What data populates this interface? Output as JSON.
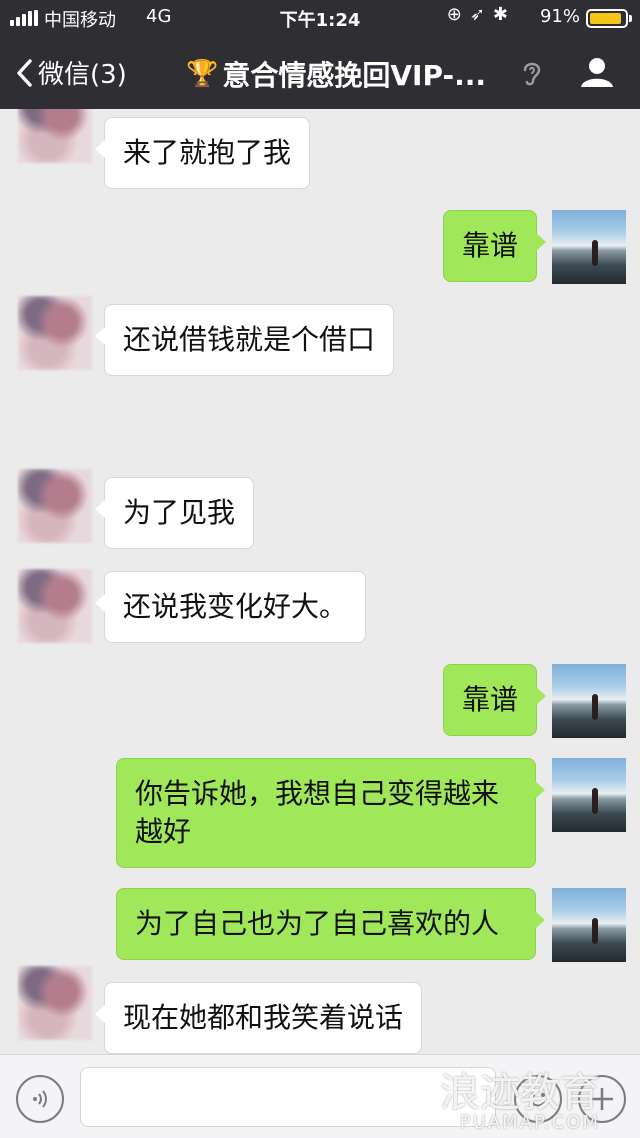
{
  "status_bar": {
    "carrier": "中国移动",
    "network": "4G",
    "time": "下午1:24",
    "battery_percent": "91%",
    "battery_level": 0.91,
    "icons": [
      "lock-rotation-icon",
      "location-icon",
      "bluetooth-icon"
    ]
  },
  "nav": {
    "back_label": "微信(3)",
    "title_icon": "🏆",
    "title": "意合情感挽回VIP-...",
    "ear_icon": "ear-icon",
    "profile_icon": "person-icon"
  },
  "messages": [
    {
      "side": "left",
      "text": "来了就抱了我"
    },
    {
      "side": "right",
      "text": "靠谱"
    },
    {
      "side": "left",
      "text": "还说借钱就是个借口"
    },
    {
      "side": "left",
      "text": "为了见我"
    },
    {
      "side": "left",
      "text": "还说我变化好大。"
    },
    {
      "side": "right",
      "text": "靠谱"
    },
    {
      "side": "right",
      "text": "你告诉她，我想自己变得越来越好"
    },
    {
      "side": "right",
      "text": "为了自己也为了自己喜欢的人"
    },
    {
      "side": "left",
      "text": "现在她都和我笑着说话"
    }
  ],
  "input_bar": {
    "voice_icon": "voice-icon",
    "emoji_icon": "emoji-icon",
    "plus_icon": "plus-icon"
  },
  "watermark": {
    "text": "浪迹教育",
    "subtext": "PUAMAP.COM"
  },
  "colors": {
    "nav_bg": "#2e2e33",
    "chat_bg": "#ebebeb",
    "outgoing_bubble": "#a0e75a",
    "incoming_bubble": "#ffffff",
    "battery": "#f5c518"
  }
}
